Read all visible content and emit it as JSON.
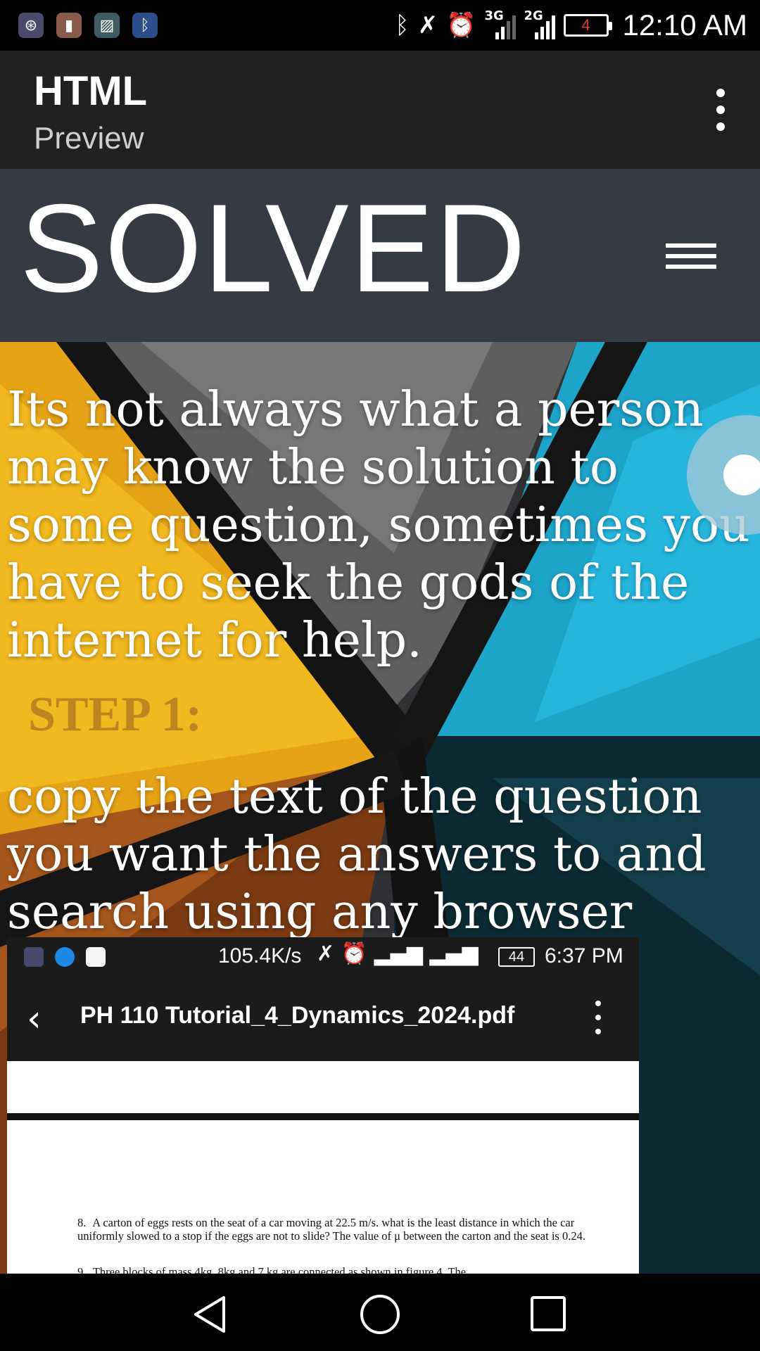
{
  "status_bar": {
    "time": "12:10 AM",
    "battery_level": "4",
    "network_1": "3G",
    "network_2": "2G",
    "app_icons": [
      "focus-app-icon",
      "clipboard-icon",
      "gallery-icon",
      "bluetooth-app-icon"
    ],
    "symbols": [
      "bluetooth-icon",
      "mute-icon",
      "alarm-icon"
    ]
  },
  "app_bar": {
    "title": "HTML",
    "subtitle": "Preview"
  },
  "web_header": {
    "site_title": "SOLVED"
  },
  "content": {
    "intro": "Its not always what a person may know the solution to some question, sometimes you have to seek the gods of the internet for help.",
    "step_label": "STEP 1:",
    "step_text": "copy the text of the question you want the answers to and search using any browser"
  },
  "embedded_screenshot": {
    "status_speed": "105.4K/s",
    "status_battery": "44",
    "status_time": "6:37 PM",
    "pdf_title": "PH 110 Tutorial_4_Dynamics_2024.pdf",
    "questions": [
      {
        "number": "8.",
        "text": "A carton of eggs rests on the seat of a car moving at 22.5 m/s. what is the least distance in which the car uniformly slowed to a stop if the eggs are not to slide? The value of μ between the carton and the seat is 0.24."
      },
      {
        "number": "9.",
        "text": "Three blocks of mass 4kg, 8kg and 7 kg are connected as shown in figure 4. The"
      }
    ]
  },
  "colors": {
    "app_bar": "#212121",
    "web_header": "#353a43",
    "step_label": "#bd8420",
    "battery_low": "#e53935"
  }
}
